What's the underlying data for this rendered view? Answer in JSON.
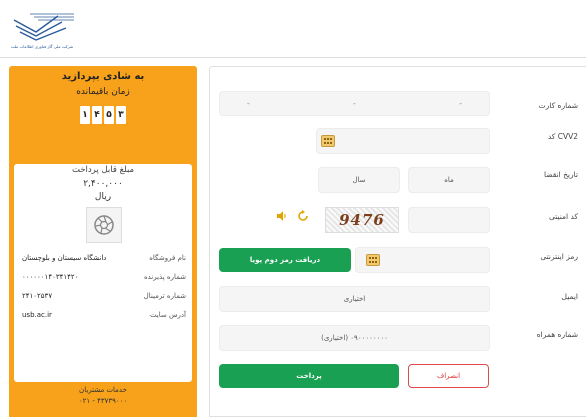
{
  "header": {
    "logo_caption": "شرکت ملی گاز فناوری اطلاعات ملت"
  },
  "sidebar": {
    "title": "به شادی بپردازید",
    "time_label": "زمان باقیمانده",
    "timer_digits": [
      "۳",
      "۵",
      "۴",
      "۱"
    ],
    "amount_title": "مبلغ قابل پرداخت",
    "amount_value": "۲,۴۰۰,۰۰۰",
    "amount_unit": "ریال",
    "info": [
      {
        "label": "نام فروشگاه",
        "value": "دانشگاه سیستان و بلوچستان"
      },
      {
        "label": "شماره پذیرنده",
        "value": "۰۰۰۰۰۰۱۴۰۳۴۱۴۲۰"
      },
      {
        "label": "شماره ترمینال",
        "value": "۲۴۱۰۲۵۳۷"
      },
      {
        "label": "آدرس سایت",
        "value": "usb.ac.ir"
      }
    ],
    "support_label": "خدمات مشتریان",
    "support_number": "۰۲۱ - ۴۳۷۳۹۰۰۰"
  },
  "form": {
    "card_number_label": "شماره کارت",
    "card_number_dashes": [
      "-",
      "-",
      "-"
    ],
    "cvv2_label": "کد CVV2",
    "expiry_label": "تاریخ انقضا",
    "month_placeholder": "ماه",
    "year_placeholder": "سال",
    "security_code_label": "کد امنیتی",
    "captcha_text": "9476",
    "otp_label": "رمز اینترنتی",
    "otp_button": "دریافت رمز دوم پویا",
    "email_label": "ایمیل",
    "email_placeholder": "اختیاری",
    "mobile_label": "شماره همراه",
    "mobile_placeholder": "(اختیاری) ۰۹۰۰۰۰۰۰۰۰",
    "pay_button": "پرداخت",
    "cancel_button": "انصراف"
  },
  "colors": {
    "accent_orange": "#f7a21a",
    "pay_green": "#1aa052",
    "cancel_red": "#e24a4a"
  }
}
